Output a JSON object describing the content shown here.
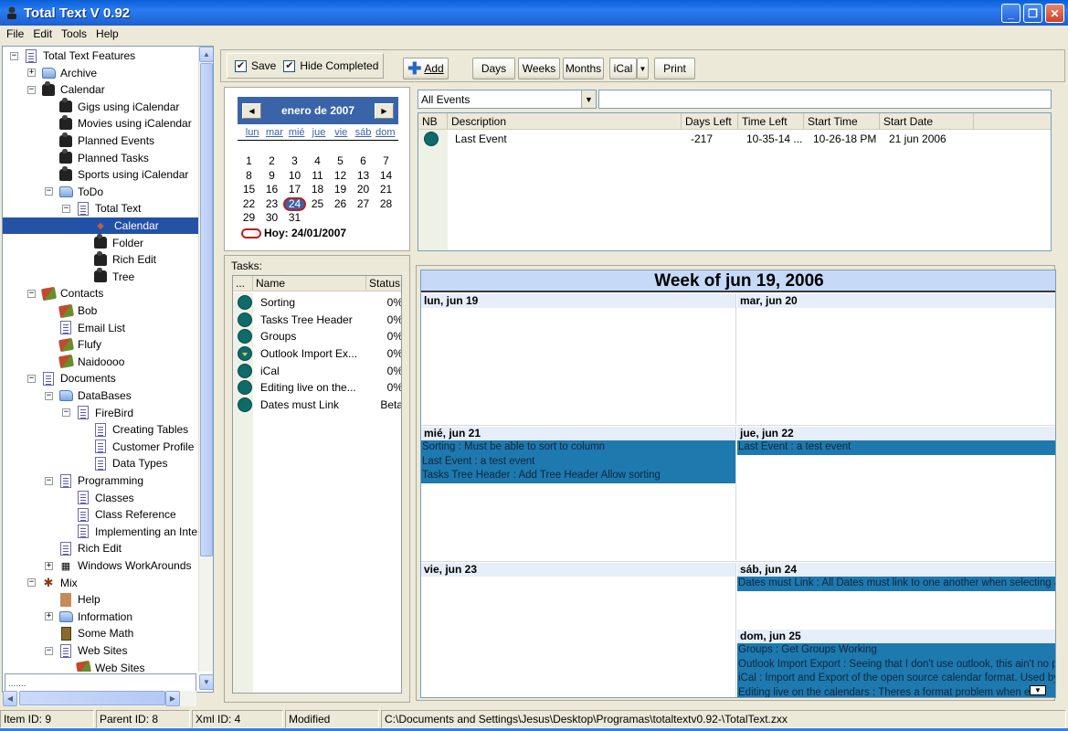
{
  "window": {
    "title": "Total Text V 0.92",
    "controls": [
      "minimize",
      "restore",
      "close"
    ]
  },
  "menu": [
    "File",
    "Edit",
    "Tools",
    "Help"
  ],
  "tree": {
    "nodes": [
      {
        "label": "Total Text Features",
        "level": 0,
        "icon": "document-icon",
        "expander": "minus"
      },
      {
        "label": "Archive",
        "level": 1,
        "icon": "folder-icon",
        "expander": "plus"
      },
      {
        "label": "Calendar",
        "level": 1,
        "icon": "camera-icon",
        "expander": "minus"
      },
      {
        "label": "Gigs using iCalendar",
        "level": 2,
        "icon": "camera-icon",
        "expander": ""
      },
      {
        "label": "Movies using iCalendar",
        "level": 2,
        "icon": "camera-icon",
        "expander": ""
      },
      {
        "label": "Planned Events",
        "level": 2,
        "icon": "camera-icon",
        "expander": ""
      },
      {
        "label": "Planned Tasks",
        "level": 2,
        "icon": "camera-icon",
        "expander": ""
      },
      {
        "label": "Sports using iCalendar",
        "level": 2,
        "icon": "camera-icon",
        "expander": ""
      },
      {
        "label": "ToDo",
        "level": 2,
        "icon": "folder-icon",
        "expander": "minus"
      },
      {
        "label": "Total Text",
        "level": 3,
        "icon": "document-icon",
        "expander": "minus"
      },
      {
        "label": "Calendar",
        "level": 4,
        "icon": "bullet-icon",
        "expander": "",
        "selected": true
      },
      {
        "label": "Folder",
        "level": 4,
        "icon": "camera-icon",
        "expander": ""
      },
      {
        "label": "Rich Edit",
        "level": 4,
        "icon": "camera-icon",
        "expander": ""
      },
      {
        "label": "Tree",
        "level": 4,
        "icon": "camera-icon",
        "expander": ""
      },
      {
        "label": "Contacts",
        "level": 1,
        "icon": "house-icon",
        "expander": "minus"
      },
      {
        "label": "Bob",
        "level": 2,
        "icon": "house-icon",
        "expander": ""
      },
      {
        "label": "Email List",
        "level": 2,
        "icon": "document-icon",
        "expander": ""
      },
      {
        "label": "Flufy",
        "level": 2,
        "icon": "house-icon",
        "expander": ""
      },
      {
        "label": "Naidoooo",
        "level": 2,
        "icon": "house-icon",
        "expander": ""
      },
      {
        "label": "Documents",
        "level": 1,
        "icon": "document-icon",
        "expander": "minus"
      },
      {
        "label": "DataBases",
        "level": 2,
        "icon": "folder-icon",
        "expander": "minus"
      },
      {
        "label": "FireBird",
        "level": 3,
        "icon": "document-icon",
        "expander": "minus"
      },
      {
        "label": "Creating Tables",
        "level": 4,
        "icon": "document-icon",
        "expander": ""
      },
      {
        "label": "Customer Profile",
        "level": 4,
        "icon": "document-icon",
        "expander": ""
      },
      {
        "label": "Data Types",
        "level": 4,
        "icon": "document-icon",
        "expander": ""
      },
      {
        "label": "Programming",
        "level": 2,
        "icon": "document-icon",
        "expander": "minus"
      },
      {
        "label": "Classes",
        "level": 3,
        "icon": "document-icon",
        "expander": ""
      },
      {
        "label": "Class Reference",
        "level": 3,
        "icon": "document-icon",
        "expander": ""
      },
      {
        "label": "Implementing an Interfa",
        "level": 3,
        "icon": "document-icon",
        "expander": ""
      },
      {
        "label": "Rich Edit",
        "level": 2,
        "icon": "document-icon",
        "expander": ""
      },
      {
        "label": "Windows WorkArounds",
        "level": 2,
        "icon": "windows-icon",
        "expander": "plus"
      },
      {
        "label": "Mix",
        "level": 1,
        "icon": "mix-icon",
        "expander": "minus"
      },
      {
        "label": "Help",
        "level": 2,
        "icon": "help-book-icon",
        "expander": ""
      },
      {
        "label": "Information",
        "level": 2,
        "icon": "folder-icon",
        "expander": "plus"
      },
      {
        "label": "Some Math",
        "level": 2,
        "icon": "calculator-icon",
        "expander": ""
      },
      {
        "label": "Web Sites",
        "level": 2,
        "icon": "document-icon",
        "expander": "minus"
      },
      {
        "label": "Web Sites",
        "level": 3,
        "icon": "house-icon",
        "expander": ""
      }
    ],
    "input_value": "......."
  },
  "toolbar": {
    "save_label": "Save",
    "save_checked": true,
    "hide_completed_label": "Hide Completed",
    "hide_completed_checked": true,
    "add_label": "Add",
    "days_label": "Days",
    "weeks_label": "Weeks",
    "months_label": "Months",
    "ical_label": "iCal",
    "print_label": "Print"
  },
  "calendar": {
    "month_title": "enero de 2007",
    "weekdays": [
      "lun",
      "mar",
      "mié",
      "jue",
      "vie",
      "sáb",
      "dom"
    ],
    "days": [
      "1",
      "2",
      "3",
      "4",
      "5",
      "6",
      "7",
      "8",
      "9",
      "10",
      "11",
      "12",
      "13",
      "14",
      "15",
      "16",
      "17",
      "18",
      "19",
      "20",
      "21",
      "22",
      "23",
      "24",
      "25",
      "26",
      "27",
      "28",
      "29",
      "30",
      "31"
    ],
    "today_day": "24",
    "today_label": "Hoy: 24/01/2007"
  },
  "tasks": {
    "label": "Tasks:",
    "columns": [
      "...",
      "Name",
      "Status"
    ],
    "rows": [
      {
        "name": "Sorting",
        "status": "0%",
        "flag": false
      },
      {
        "name": "Tasks Tree Header",
        "status": "0%",
        "flag": false
      },
      {
        "name": "Groups",
        "status": "0%",
        "flag": false
      },
      {
        "name": "Outlook Import Ex...",
        "status": "0%",
        "flag": true
      },
      {
        "name": "iCal",
        "status": "0%",
        "flag": false
      },
      {
        "name": "Editing live on the...",
        "status": "0%",
        "flag": false
      },
      {
        "name": "Dates must Link",
        "status": "Beta",
        "flag": false
      }
    ]
  },
  "events": {
    "filter_value": "All Events",
    "search_value": "",
    "columns": [
      "NB",
      "Description",
      "Days Left",
      "Time Left",
      "Start Time",
      "Start Date"
    ],
    "rows": [
      {
        "description": "Last Event",
        "days_left": "-217",
        "time_left": "10-35-14 ...",
        "start_time": "10-26-18 PM",
        "start_date": "21 jun 2006"
      }
    ]
  },
  "week": {
    "title": "Week of jun 19, 2006",
    "days": [
      {
        "label": "lun, jun 19",
        "events": []
      },
      {
        "label": "mar, jun 20",
        "events": []
      },
      {
        "label": "mié, jun 21",
        "events": [
          "Sorting : Must be able to sort to column",
          "Last Event : a test event",
          "Tasks Tree Header : Add Tree Header  Allow sorting"
        ]
      },
      {
        "label": "jue, jun 22",
        "events": [
          "Last Event : a test event"
        ]
      },
      {
        "label": "vie, jun 23",
        "events": []
      },
      {
        "label": "sáb, jun 24",
        "events": [
          "Dates must Link : All Dates must link to one another when selecting a i"
        ]
      },
      {
        "label": "dom, jun 25",
        "events": [
          "Groups : Get Groups Working",
          "Outlook Import Export : Seeing that I don't use outlook, this ain't no prio",
          "iCal : Import and Export of the open source calendar format. Used by g",
          "Editing live on the calendars : Theres a format problem when editi"
        ]
      }
    ]
  },
  "status": {
    "item_id": "Item ID: 9",
    "parent_id": "Parent ID: 8",
    "xml_id": "Xml ID: 4",
    "state": "Modified",
    "path": "C:\\Documents and Settings\\Jesus\\Desktop\\Programas\\totaltextv0.92-\\TotalText.zxx"
  },
  "colors": {
    "titlebar": "#0a5fd8",
    "selection": "#2453a6",
    "calendar_header": "#3a64a8",
    "event_bar": "#1e79ae",
    "task_dot": "#0f6a6a",
    "today_circle": "#c01c1c"
  }
}
